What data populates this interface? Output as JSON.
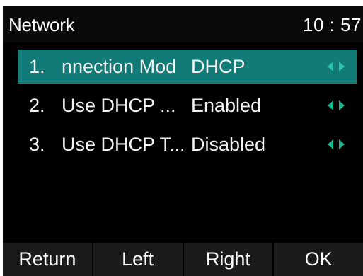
{
  "header": {
    "title": "Network",
    "time": "10 : 57"
  },
  "menu": {
    "selected_index": 0,
    "items": [
      {
        "number": "1.",
        "label": "nnection Mod",
        "value": "DHCP"
      },
      {
        "number": "2.",
        "label": "Use DHCP ...",
        "value": "Enabled"
      },
      {
        "number": "3.",
        "label": "Use DHCP T...",
        "value": "Disabled"
      }
    ]
  },
  "softkeys": {
    "return": "Return",
    "left": "Left",
    "right": "Right",
    "ok": "OK"
  },
  "colors": {
    "background": "#000000",
    "selection": "#127a77",
    "arrow": "#1ab88f",
    "softkey_bar": "#1b1b1b"
  },
  "icons": [
    "left-arrow-icon",
    "right-arrow-icon"
  ]
}
